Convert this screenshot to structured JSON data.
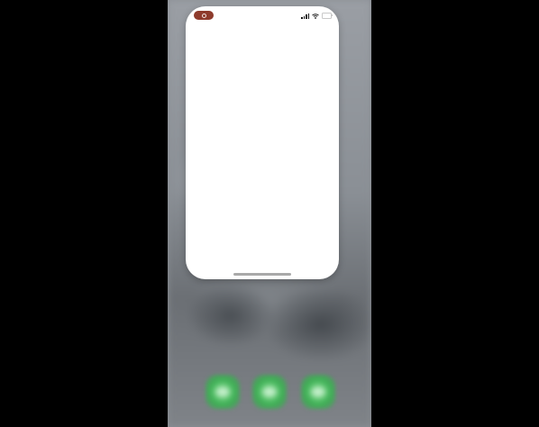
{
  "status_bar": {
    "recording_indicator_color": "#8e3b2c",
    "icons": [
      "signal-icon",
      "wifi-icon",
      "battery-icon"
    ]
  },
  "dock": {
    "icons": [
      "phone-icon",
      "messages-icon",
      "facetime-icon"
    ],
    "accent_color": "#3fae55"
  },
  "app_card": {
    "background_color": "#ffffff"
  }
}
